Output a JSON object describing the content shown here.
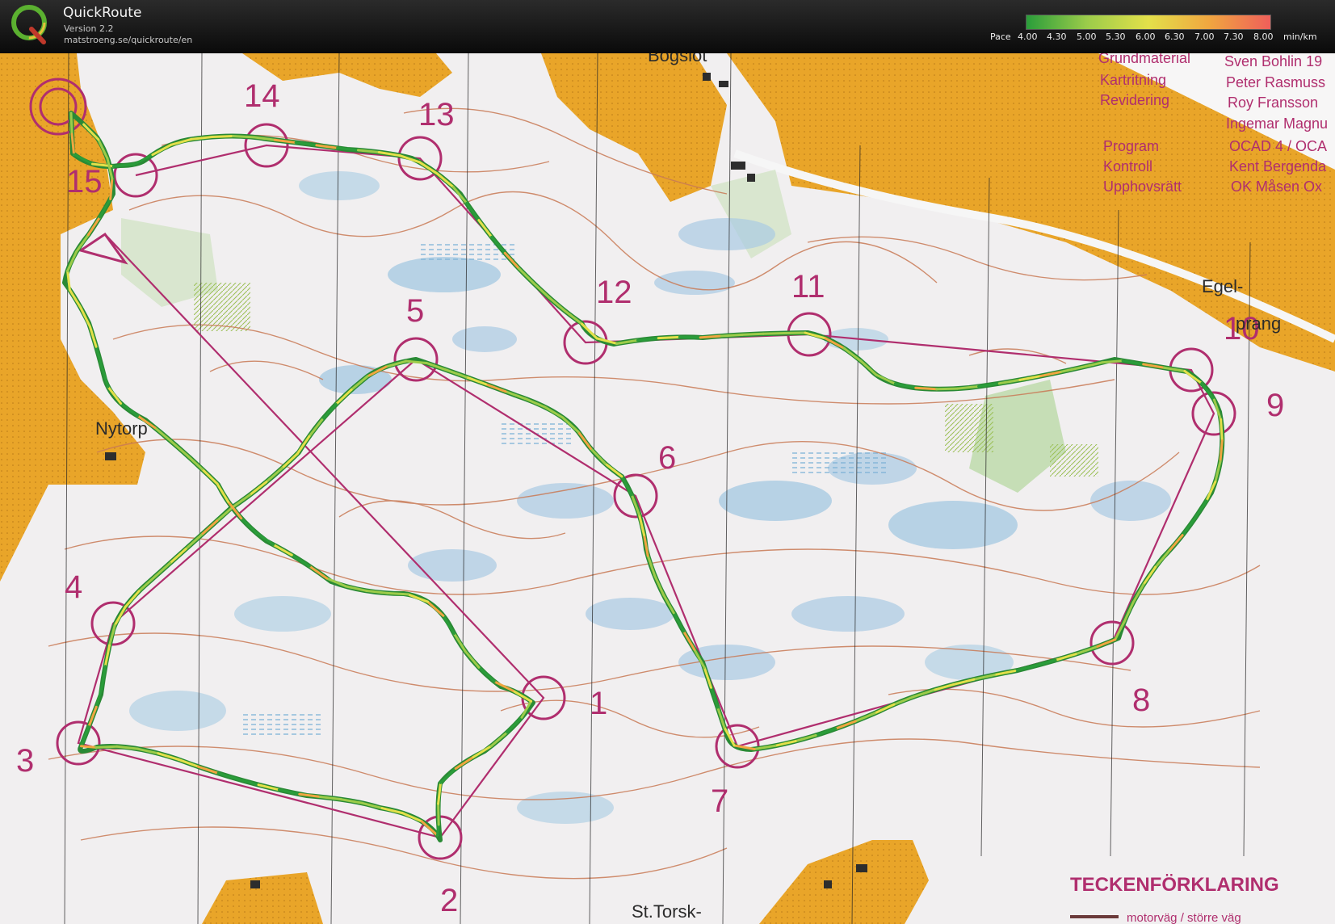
{
  "app": {
    "name": "QuickRoute",
    "version": "Version 2.2",
    "url": "matstroeng.se/quickroute/en"
  },
  "pace_legend": {
    "label": "Pace",
    "ticks": [
      "4.00",
      "4.30",
      "5.00",
      "5.30",
      "6.00",
      "6.30",
      "7.00",
      "7.30",
      "8.00"
    ],
    "unit": "min/km",
    "colors": [
      "#2a9d3a",
      "#9ccc4a",
      "#e3e04a",
      "#f0a640",
      "#ef5f5a"
    ]
  },
  "map": {
    "colors": {
      "paper": "#f1eff0",
      "open_land": "#e9a529",
      "water": "#9cc4de",
      "course": "#b02e6e",
      "contour": "#c97a56",
      "green": "#bcd9a8"
    },
    "place_names": [
      "Bogsiöt",
      "Nytorp",
      "St.Torsk-",
      "Egel-",
      "prang"
    ],
    "credits": [
      {
        "label": "Grundmaterial",
        "value": "Sven Bohlin 19"
      },
      {
        "label": "Kartritning",
        "value": "Peter Rasmuss"
      },
      {
        "label": "Revidering",
        "value": "Roy Fransson"
      },
      {
        "label": "",
        "value": "Ingemar Magnu"
      },
      {
        "label": "Program",
        "value": "OCAD 4 / OCA"
      },
      {
        "label": "Kontroll",
        "value": "Kent Bergenda"
      },
      {
        "label": "Upphovsrätt",
        "value": "OK Måsen Ox"
      }
    ],
    "legend_title": "TECKENFÖRKLARING",
    "legend_entry": "motorväg / större väg",
    "controls": [
      "1",
      "2",
      "3",
      "4",
      "5",
      "6",
      "7",
      "8",
      "9",
      "10",
      "11",
      "12",
      "13",
      "14",
      "15"
    ]
  }
}
